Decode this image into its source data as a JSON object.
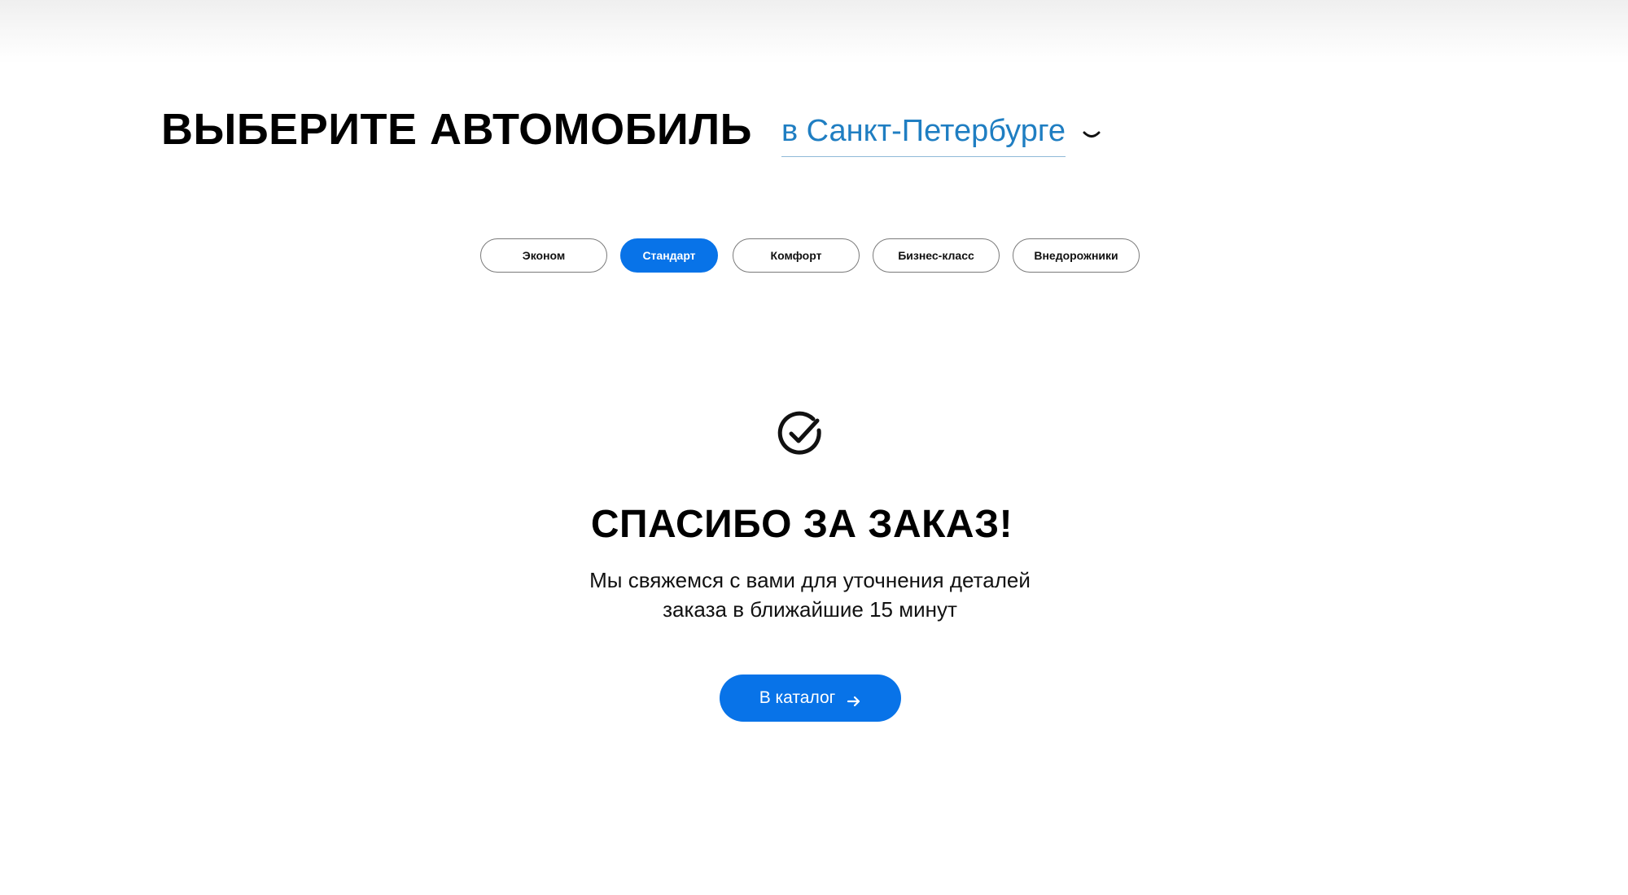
{
  "header": {
    "title": "ВЫБЕРИТЕ АВТОМОБИЛЬ",
    "city": "в Санкт-Петербурге",
    "city_icon": "chevron-down-icon"
  },
  "tabs": [
    {
      "label": "Эконом",
      "active": false
    },
    {
      "label": "Стандарт",
      "active": true
    },
    {
      "label": "Комфорт",
      "active": false
    },
    {
      "label": "Бизнес-класс",
      "active": false
    },
    {
      "label": "Внедорожники",
      "active": false
    }
  ],
  "success": {
    "icon": "check-circle-icon",
    "title": "СПАСИБО ЗА ЗАКАЗ!",
    "text_line1": "Мы свяжемся с вами для уточнения деталей",
    "text_line2": "заказа в ближайшие 15 минут",
    "button_label": "В каталог",
    "button_icon": "arrow-right-icon"
  },
  "colors": {
    "accent": "#0873e8",
    "link": "#1f7ec2",
    "text": "#000000"
  }
}
